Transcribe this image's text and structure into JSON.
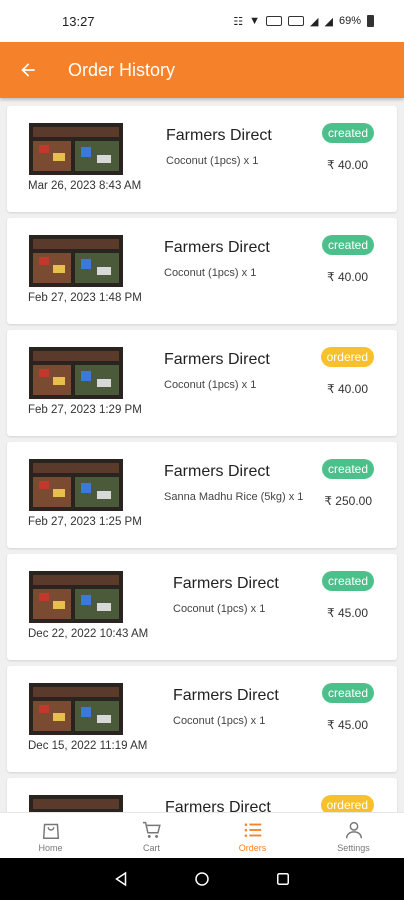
{
  "status_bar": {
    "time": "13:27",
    "battery": "69%"
  },
  "header": {
    "title": "Order History"
  },
  "orders": [
    {
      "store": "Farmers Direct",
      "item": "Coconut (1pcs) x 1",
      "status": "created",
      "price": "₹ 40.00",
      "date": "Mar 26, 2023 8:43 AM"
    },
    {
      "store": "Farmers Direct",
      "item": "Coconut (1pcs) x 1",
      "status": "created",
      "price": "₹ 40.00",
      "date": "Feb 27, 2023 1:48 PM"
    },
    {
      "store": "Farmers Direct",
      "item": "Coconut (1pcs) x 1",
      "status": "ordered",
      "price": "₹ 40.00",
      "date": "Feb 27, 2023 1:29 PM"
    },
    {
      "store": "Farmers Direct",
      "item": "Sanna Madhu Rice (5kg) x 1",
      "status": "created",
      "price": "₹ 250.00",
      "date": "Feb 27, 2023 1:25 PM"
    },
    {
      "store": "Farmers Direct",
      "item": "Coconut (1pcs) x 1",
      "status": "created",
      "price": "₹ 45.00",
      "date": "Dec 22, 2022 10:43 AM"
    },
    {
      "store": "Farmers Direct",
      "item": "Coconut (1pcs) x 1",
      "status": "created",
      "price": "₹ 45.00",
      "date": "Dec 15, 2022 11:19 AM"
    },
    {
      "store": "Farmers Direct",
      "item": "",
      "status": "ordered",
      "price": "",
      "date": ""
    }
  ],
  "bottom_nav": [
    {
      "label": "Home",
      "icon": "bag-icon"
    },
    {
      "label": "Cart",
      "icon": "cart-icon"
    },
    {
      "label": "Orders",
      "icon": "list-icon",
      "active": true
    },
    {
      "label": "Settings",
      "icon": "person-icon"
    }
  ],
  "colors": {
    "primary": "#f5822a",
    "created": "#4cc08a",
    "ordered": "#f7c02c"
  }
}
